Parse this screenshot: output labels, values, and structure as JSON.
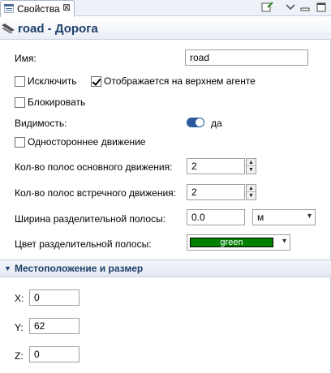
{
  "tab": {
    "label": "Свойства",
    "close": "⊠"
  },
  "header": {
    "title": "road - Дорога"
  },
  "fields": {
    "name_label": "Имя:",
    "name_value": "road",
    "exclude_label": "Исключить",
    "shown_top_label": "Отображается на верхнем агенте",
    "block_label": "Блокировать",
    "visibility_label": "Видимость:",
    "visibility_value": "да",
    "oneway_label": "Одностороннее движение",
    "main_lanes_label": "Кол-во полос основного движения:",
    "main_lanes_value": "2",
    "opposite_lanes_label": "Кол-во полос встречного движения:",
    "opposite_lanes_value": "2",
    "divider_width_label": "Ширина разделительной полосы:",
    "divider_width_value": "0.0",
    "divider_width_unit": "м",
    "divider_color_label": "Цвет разделительной полосы:",
    "divider_color_value": "green"
  },
  "checkbox_states": {
    "exclude": false,
    "shown_top": true,
    "block": false,
    "oneway": false
  },
  "colors": {
    "divider_color": "#008000",
    "accent": "#1f3f6b",
    "toggle": "#2a5a9c"
  },
  "location": {
    "section_title": "Местоположение и размер",
    "x_label": "X:",
    "x_value": "0",
    "y_label": "Y:",
    "y_value": "62",
    "z_label": "Z:",
    "z_value": "0"
  }
}
